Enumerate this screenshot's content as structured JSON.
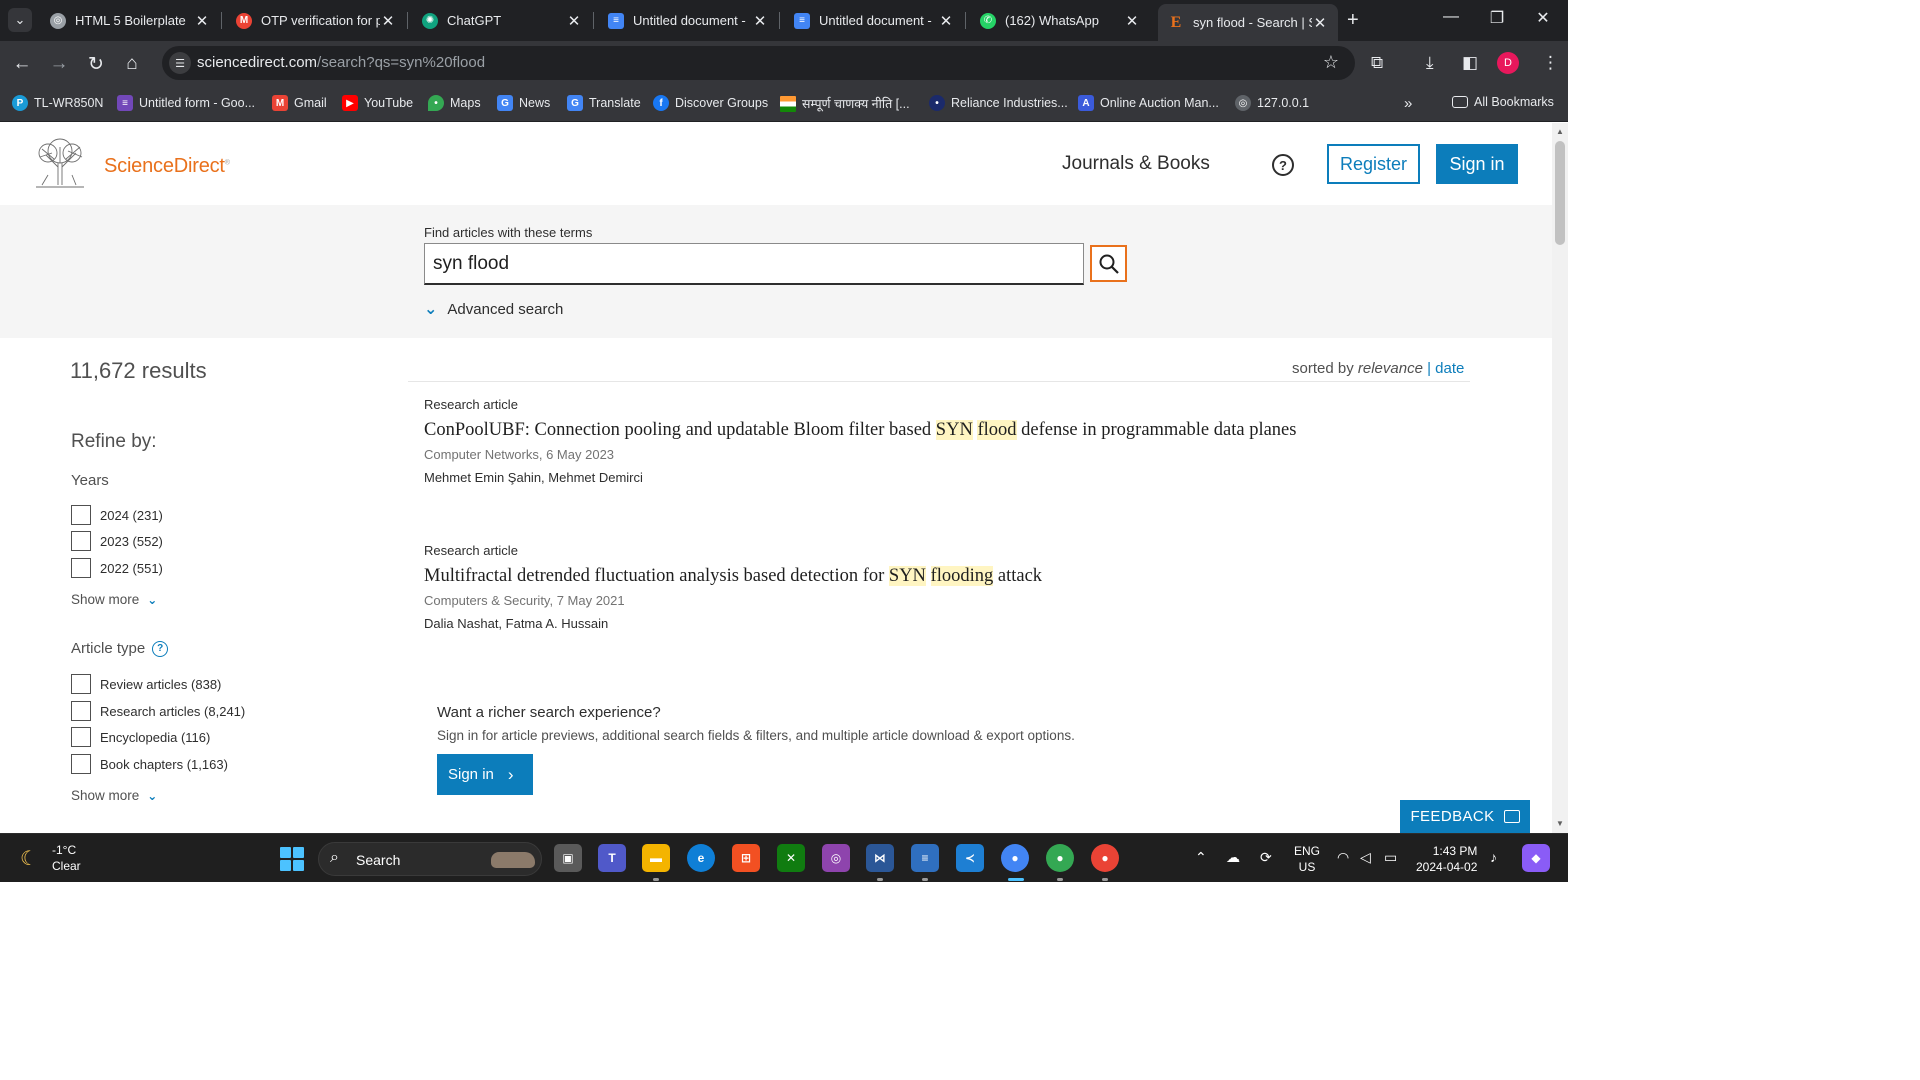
{
  "browser": {
    "tabs": [
      {
        "title": "HTML 5 Boilerplate",
        "active": false,
        "icon": "globe-icon"
      },
      {
        "title": "OTP verification for p",
        "active": false,
        "icon": "gmail-icon"
      },
      {
        "title": "ChatGPT",
        "active": false,
        "icon": "chatgpt-icon"
      },
      {
        "title": "Untitled document -",
        "active": false,
        "icon": "docs-icon"
      },
      {
        "title": "Untitled document -",
        "active": false,
        "icon": "docs-icon"
      },
      {
        "title": "(162) WhatsApp",
        "active": false,
        "icon": "whatsapp-icon"
      },
      {
        "title": "syn flood - Search | S",
        "active": true,
        "icon": "elsevier-icon"
      }
    ],
    "url_host": "sciencedirect.com",
    "url_path": "/search?qs=syn%20flood",
    "profile_initial": "D",
    "bookmarks": [
      {
        "label": "TL-WR850N",
        "icon": "tplink-icon",
        "color": "#1a9bd7"
      },
      {
        "label": "Untitled form - Goo...",
        "icon": "forms-icon",
        "color": "#7248b9"
      },
      {
        "label": "Gmail",
        "icon": "gmail-icon",
        "color": "#ea4335"
      },
      {
        "label": "YouTube",
        "icon": "youtube-icon",
        "color": "#ff0000"
      },
      {
        "label": "Maps",
        "icon": "maps-icon",
        "color": "#34a853"
      },
      {
        "label": "News",
        "icon": "news-icon",
        "color": "#4285f4"
      },
      {
        "label": "Translate",
        "icon": "translate-icon",
        "color": "#4285f4"
      },
      {
        "label": "Discover Groups",
        "icon": "facebook-icon",
        "color": "#1877f2"
      },
      {
        "label": "सम्पूर्ण चाणक्य नीति [...",
        "icon": "india-flag-icon",
        "color": "#ff9933"
      },
      {
        "label": "Reliance Industries...",
        "icon": "reliance-icon",
        "color": "#1b2a6b"
      },
      {
        "label": "Online Auction Man...",
        "icon": "auction-icon",
        "color": "#3b5bdb"
      },
      {
        "label": "127.0.0.1",
        "icon": "globe-icon",
        "color": "#5f6368"
      }
    ],
    "all_bookmarks": "All Bookmarks"
  },
  "header": {
    "brand": "ScienceDirect",
    "journals_books": "Journals & Books",
    "register": "Register",
    "sign_in": "Sign in"
  },
  "search": {
    "label": "Find articles with these terms",
    "query": "syn flood",
    "advanced": "Advanced search"
  },
  "results": {
    "count": "11,672 results",
    "sorted_prefix": "sorted by",
    "sorted_relevance": "relevance",
    "sorted_separator": "|",
    "sorted_date": "date",
    "items": [
      {
        "type": "Research article",
        "title_before": "ConPoolUBF: Connection pooling and updatable Bloom filter based ",
        "hl1": "SYN",
        "mid": " ",
        "hl2": "flood",
        "title_after": " defense in programmable data planes",
        "source": "Computer Networks, 6 May 2023",
        "authors": "Mehmet Emin Şahin, Mehmet Demirci"
      },
      {
        "type": "Research article",
        "title_before": "Multifractal detrended fluctuation analysis based detection for ",
        "hl1": "SYN",
        "mid": " ",
        "hl2": "flooding",
        "title_after": " attack",
        "source": "Computers & Security, 7 May 2021",
        "authors": "Dalia Nashat, Fatma A. Hussain"
      }
    ]
  },
  "refine": {
    "title": "Refine by:",
    "years_title": "Years",
    "years": [
      "2024 (231)",
      "2023 (552)",
      "2022 (551)"
    ],
    "article_type_title": "Article type",
    "article_types": [
      "Review articles (838)",
      "Research articles (8,241)",
      "Encyclopedia (116)",
      "Book chapters (1,163)"
    ],
    "show_more": "Show more"
  },
  "promo": {
    "title": "Want a richer search experience?",
    "text": "Sign in for article previews, additional search fields & filters, and multiple article download & export options.",
    "button": "Sign in"
  },
  "feedback": "FEEDBACK",
  "taskbar": {
    "temp": "-1°C",
    "condition": "Clear",
    "search": "Search",
    "lang_top": "ENG",
    "lang_bottom": "US",
    "time": "1:43 PM",
    "date": "2024-04-02"
  },
  "colors": {
    "accent_blue": "#0c7dbb",
    "brand_orange": "#e9711c",
    "highlight": "#fff5c2"
  }
}
